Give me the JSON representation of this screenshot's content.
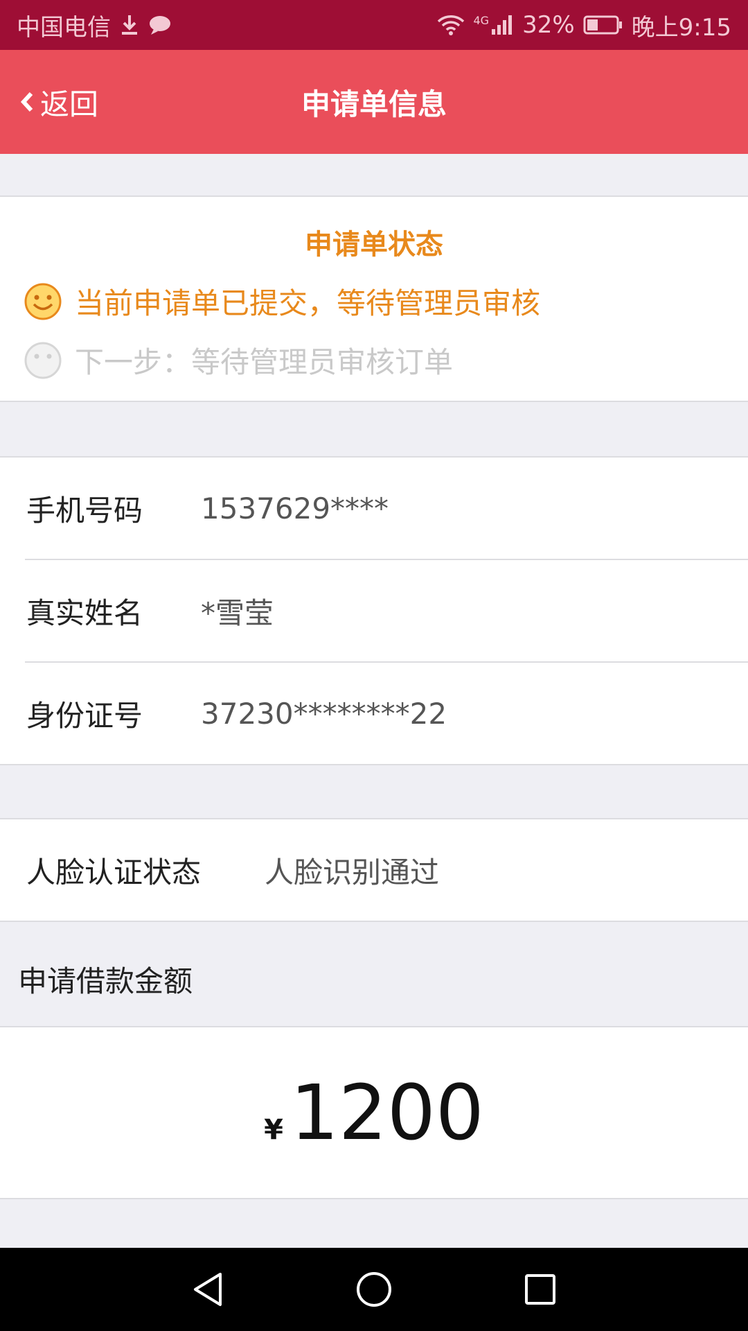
{
  "status_bar": {
    "carrier": "中国电信",
    "network": "4G",
    "battery": "32%",
    "time": "晚上9:15"
  },
  "header": {
    "back_label": "返回",
    "title": "申请单信息"
  },
  "status_card": {
    "title": "申请单状态",
    "current": "当前申请单已提交，等待管理员审核",
    "next": "下一步：等待管理员审核订单"
  },
  "info": {
    "rows": [
      {
        "label": "手机号码",
        "value": "1537629****"
      },
      {
        "label": "真实姓名",
        "value": "*雪莹"
      },
      {
        "label": "身份证号",
        "value": "37230********22"
      }
    ]
  },
  "face": {
    "label": "人脸认证状态",
    "value": "人脸识别通过"
  },
  "loan": {
    "label": "申请借款金额",
    "currency": "¥",
    "amount": "1200"
  },
  "colors": {
    "status_bar": "#9e0e35",
    "header": "#ea4e5a",
    "status_accent": "#e8891c"
  }
}
